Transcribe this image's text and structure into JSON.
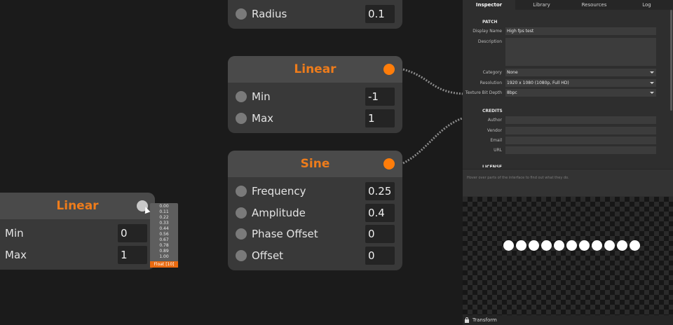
{
  "nodes": {
    "radius": {
      "rows": [
        {
          "label": "Radius",
          "value": "0.1"
        }
      ]
    },
    "linear_center": {
      "title": "Linear",
      "rows": [
        {
          "label": "Min",
          "value": "-1"
        },
        {
          "label": "Max",
          "value": "1"
        }
      ]
    },
    "sine": {
      "title": "Sine",
      "rows": [
        {
          "label": "Frequency",
          "value": "0.25"
        },
        {
          "label": "Amplitude",
          "value": "0.4"
        },
        {
          "label": "Phase Offset",
          "value": "0"
        },
        {
          "label": "Offset",
          "value": "0"
        }
      ]
    },
    "linear_left": {
      "title": "Linear",
      "rows": [
        {
          "label": "Min",
          "value": "0"
        },
        {
          "label": "Max",
          "value": "1"
        }
      ]
    }
  },
  "port_popup": {
    "values": [
      "0.00",
      "0.11",
      "0.22",
      "0.33",
      "0.44",
      "0.56",
      "0.67",
      "0.78",
      "0.89",
      "1.00"
    ],
    "type_label": "Float [10]"
  },
  "panel": {
    "tabs": [
      "Inspector",
      "Library",
      "Resources",
      "Log"
    ],
    "active_tab": "Inspector",
    "patch": {
      "section_title": "PATCH",
      "display_name_label": "Display Name",
      "display_name_value": "High fps test",
      "description_label": "Description",
      "description_value": "",
      "category_label": "Category",
      "category_value": "None",
      "resolution_label": "Resolution",
      "resolution_value": "1920 x 1080 (1080p, Full HD)",
      "bit_depth_label": "Texture Bit Depth",
      "bit_depth_value": "8bpc"
    },
    "credits": {
      "section_title": "CREDITS",
      "author_label": "Author",
      "vendor_label": "Vendor",
      "email_label": "Email",
      "url_label": "URL"
    },
    "license_title": "LICENSE",
    "help_text": "Hover over parts of the interface to find out what they do.",
    "status_label": "Transform"
  },
  "preview": {
    "dot_count": 11,
    "dot_color": "#ffffff"
  },
  "colors": {
    "accent": "#ff7d0a",
    "node_title": "#ee7c1b",
    "canvas_bg": "#1b1b1b"
  },
  "icons": [
    "lock-icon",
    "chevron-down-icon"
  ]
}
